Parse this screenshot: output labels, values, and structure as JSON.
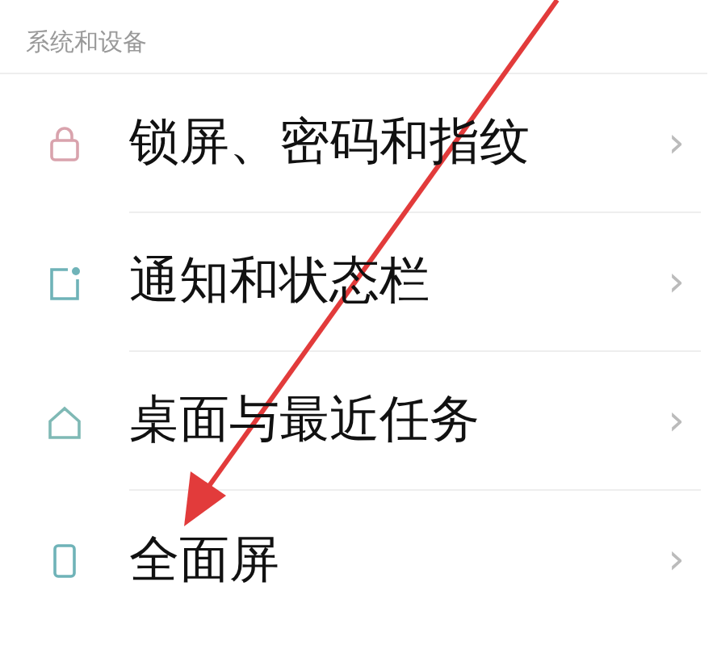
{
  "section": {
    "title": "系统和设备"
  },
  "items": [
    {
      "kind": "lock",
      "label": "锁屏、密码和指纹",
      "chevron": "›"
    },
    {
      "kind": "notification",
      "label": "通知和状态栏",
      "chevron": "›"
    },
    {
      "kind": "home",
      "label": "桌面与最近任务",
      "chevron": "›"
    },
    {
      "kind": "phone",
      "label": "全面屏",
      "chevron": "›"
    }
  ]
}
